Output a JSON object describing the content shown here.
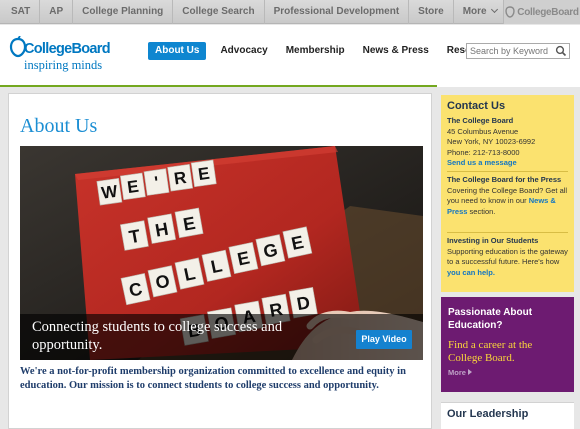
{
  "topnav": {
    "items": [
      "SAT",
      "AP",
      "College Planning",
      "College Search",
      "Professional Development",
      "Store",
      "More"
    ],
    "brand": "CollegeBoard"
  },
  "header": {
    "logo_name": "CollegeBoard",
    "logo_tagline": "inspiring minds",
    "nav": [
      "About Us",
      "Advocacy",
      "Membership",
      "News & Press",
      "Research"
    ],
    "active_nav": "About Us",
    "search_placeholder": "Search by Keyword",
    "accent_color": "#0e86d0"
  },
  "main": {
    "title": "About Us",
    "hero": {
      "tiles": [
        "WE'RE",
        "THE",
        "COLLEGE",
        "BOARD"
      ],
      "caption": "Connecting students to college success and opportunity.",
      "play_label": "Play Video"
    },
    "intro": "We're a not-for-profit membership organization committed to excellence and equity in education. Our mission is to connect students to college success and opportunity."
  },
  "sidebar": {
    "contact": {
      "heading": "Contact Us",
      "org": "The College Board",
      "address1": "45 Columbus Avenue",
      "address2": "New York, NY 10023-6992",
      "phone": "Phone: 212-713-8000",
      "link": "Send us a message",
      "press_heading": "The College Board for the Press",
      "press_text": "Covering the College Board? Get all you need to know in our",
      "press_link": "News & Press",
      "press_end": "section.",
      "invest_heading": "Investing in Our Students",
      "invest_text": "Supporting education is the gateway to a successful future. Here's how",
      "invest_link": "you can help."
    },
    "promo": {
      "heading": "Passionate About Education?",
      "text": "Find a career at the College Board.",
      "more": "More"
    },
    "leadership": "Our Leadership"
  }
}
